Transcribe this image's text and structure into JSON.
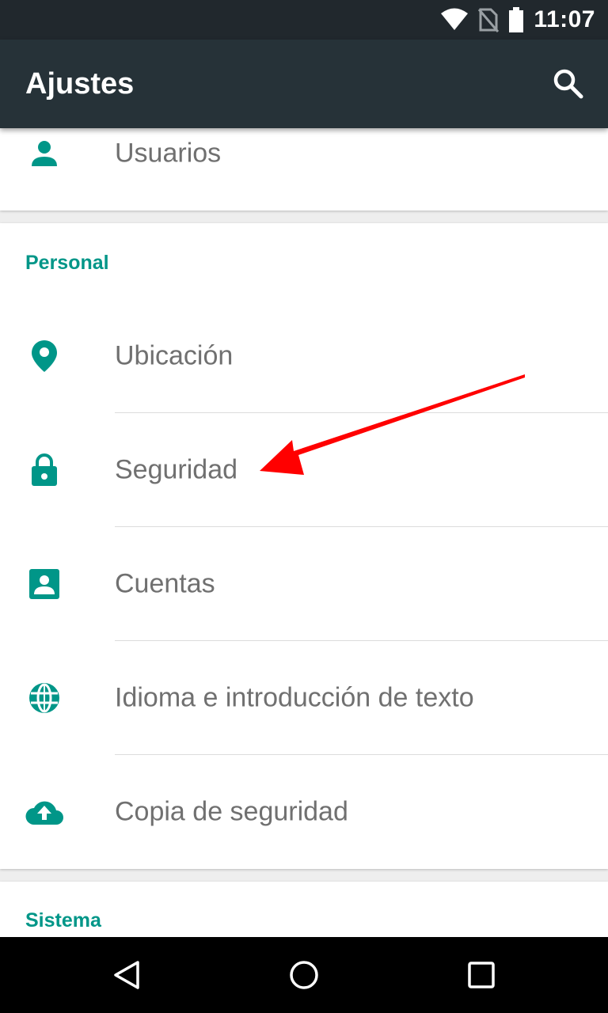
{
  "status_bar": {
    "time": "11:07",
    "icons": [
      "wifi-icon",
      "no-sim-icon",
      "battery-icon"
    ]
  },
  "app_bar": {
    "title": "Ajustes",
    "search_icon": "search-icon"
  },
  "users_row": {
    "label": "Usuarios",
    "icon": "person-icon"
  },
  "personal": {
    "header": "Personal",
    "items": [
      {
        "label": "Ubicación",
        "icon": "location-pin-icon"
      },
      {
        "label": "Seguridad",
        "icon": "lock-icon"
      },
      {
        "label": "Cuentas",
        "icon": "account-box-icon"
      },
      {
        "label": "Idioma e introducción de texto",
        "icon": "globe-icon"
      },
      {
        "label": "Copia de seguridad",
        "icon": "cloud-upload-icon"
      }
    ]
  },
  "system": {
    "header": "Sistema"
  },
  "nav_bar": {
    "icons": [
      "back-icon",
      "home-icon",
      "recents-icon"
    ]
  },
  "colors": {
    "accent": "#009688",
    "app_bar": "#263238",
    "status_bar": "#21282d",
    "annotation": "#ff0000"
  }
}
